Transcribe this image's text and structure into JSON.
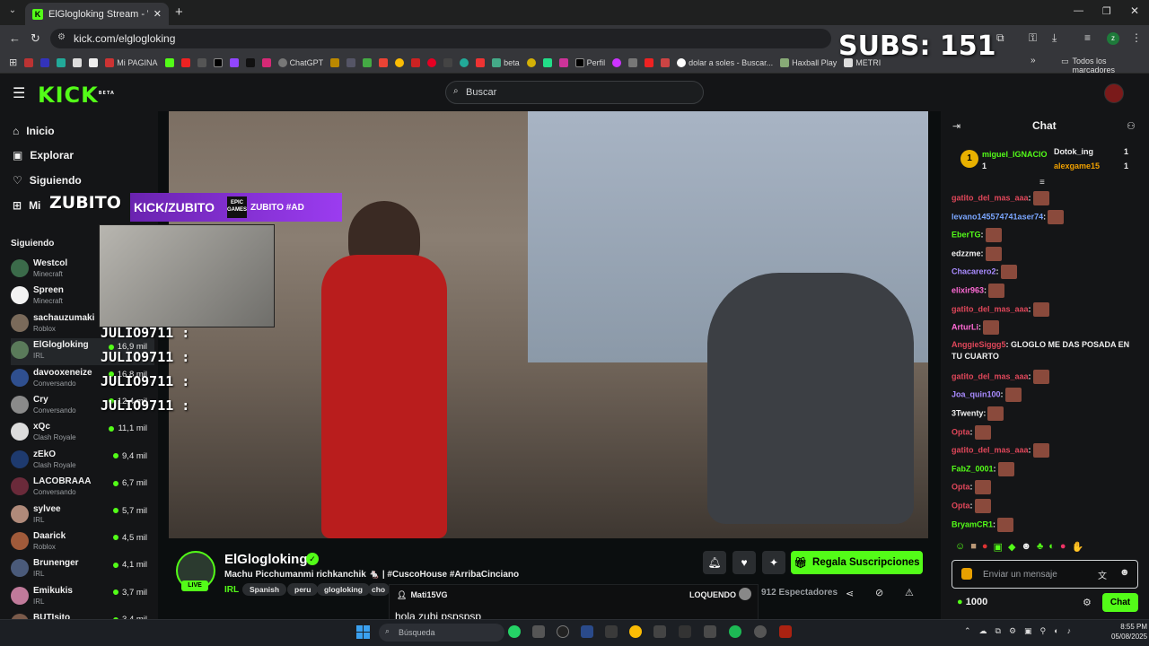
{
  "browser": {
    "tab_title": "ElGlogloking Stream - Watch L",
    "url": "kick.com/elglogloking",
    "bookmarks": [
      "Mi PAGINA",
      "ChatGPT",
      "beta",
      "Perfil",
      "dolar a soles - Buscar...",
      "Haxball Play",
      "METRI",
      "Todos los marcadores"
    ]
  },
  "overlay": {
    "subs_text": "SUBS: 151",
    "banner_text": "KICK/ZUBITO",
    "zubito_logo": "ZUBITO",
    "epic": "EPIC",
    "epic_sub": "GAMES",
    "code_label": "ZUBITO #AD",
    "julio_lines": [
      "JULIO9711 :",
      "JULIO9711 :",
      "JULIO9711 :",
      "JULIO9711 :"
    ]
  },
  "kick": {
    "logo": "KICK",
    "beta": "BETA",
    "search_placeholder": "Buscar"
  },
  "sidebar": {
    "nav": [
      {
        "label": "Inicio",
        "icon": "home-icon"
      },
      {
        "label": "Explorar",
        "icon": "compass-icon"
      },
      {
        "label": "Siguiendo",
        "icon": "heart-icon"
      },
      {
        "label": "Mi",
        "icon": "grid-icon"
      }
    ],
    "following_heading": "Siguiendo",
    "following": [
      {
        "name": "Westcol",
        "category": "Minecraft",
        "viewers": "",
        "color": "#3b6b4a"
      },
      {
        "name": "Spreen",
        "category": "Minecraft",
        "viewers": "",
        "color": "#f2f2f2"
      },
      {
        "name": "sachauzumaki",
        "category": "Roblox",
        "viewers": "",
        "color": "#7a6a5a"
      },
      {
        "name": "ElGlogloking",
        "category": "IRL",
        "viewers": "16,9 mil",
        "color": "#5a7a5a"
      },
      {
        "name": "davooxeneize",
        "category": "Conversando",
        "viewers": "16,8 mil",
        "color": "#2f4f8f"
      },
      {
        "name": "Cry",
        "category": "Conversando",
        "viewers": "12,4 mil",
        "color": "#8a8a8a"
      },
      {
        "name": "xQc",
        "category": "Clash Royale",
        "viewers": "11,1 mil",
        "color": "#dcdcdc"
      },
      {
        "name": "zEkO",
        "category": "Clash Royale",
        "viewers": "9,4 mil",
        "color": "#1e3a6e"
      },
      {
        "name": "LACOBRAAA",
        "category": "Conversando",
        "viewers": "6,7 mil",
        "color": "#6a2a3a"
      },
      {
        "name": "sylvee",
        "category": "IRL",
        "viewers": "5,7 mil",
        "color": "#b08a7a"
      },
      {
        "name": "Daarick",
        "category": "Roblox",
        "viewers": "4,5 mil",
        "color": "#a05a3a"
      },
      {
        "name": "Brunenger",
        "category": "IRL",
        "viewers": "4,1 mil",
        "color": "#4a5a7a"
      },
      {
        "name": "Emikukis",
        "category": "IRL",
        "viewers": "3,7 mil",
        "color": "#c07a9a"
      },
      {
        "name": "BUTIsito",
        "category": "",
        "viewers": "3,4 mil",
        "color": "#7a5a4a"
      }
    ]
  },
  "stream": {
    "streamer": "ElGlogloking",
    "live": "LIVE",
    "title": "Machu Picchumanmi richkanchik 🐁 | #CuscoHouse #ArribaCinciano",
    "category": "IRL",
    "tags": [
      "Spanish",
      "peru",
      "glogloking",
      "cho"
    ],
    "gift_label": "Regala Suscripciones",
    "viewers": "912 Espectadores"
  },
  "chat_popup": {
    "user": "Mati15VG",
    "right_user": "LOQUENDO",
    "message": "hola zubi pspspsp"
  },
  "chat": {
    "title": "Chat",
    "top_gifters": [
      {
        "name": "miguel_IGNACIO",
        "count": "1"
      },
      {
        "name": "Dotok_ing",
        "count": "1"
      },
      {
        "name": "alexgame15",
        "count": "1"
      }
    ],
    "messages": [
      {
        "user": "gatito_del_mas_aaa",
        "color": "#e0475a",
        "text": ""
      },
      {
        "user": "levano145574741aser74",
        "color": "#7aa6ff",
        "text": ""
      },
      {
        "user": "EberTG",
        "color": "#53fc18",
        "text": ""
      },
      {
        "user": "edzzme",
        "color": "#f0f0f0",
        "text": ""
      },
      {
        "user": "Chacarero2",
        "color": "#a98bff",
        "text": ""
      },
      {
        "user": "elixir963",
        "color": "#ff6ad5",
        "text": ""
      },
      {
        "user": "gatito_del_mas_aaa",
        "color": "#e0475a",
        "text": ""
      },
      {
        "user": "ArturLi",
        "color": "#ff6ad5",
        "text": ""
      },
      {
        "user": "AnggieSiggg5",
        "color": "#e0475a",
        "text": "GLOGLO ME DAS POSADA EN TU CUARTO"
      },
      {
        "user": "gatito_del_mas_aaa",
        "color": "#e0475a",
        "text": ""
      },
      {
        "user": "Joa_quin100",
        "color": "#a98bff",
        "text": ""
      },
      {
        "user": "3Twenty",
        "color": "#f0f0f0",
        "text": ""
      },
      {
        "user": "Opta",
        "color": "#e0475a",
        "text": ""
      },
      {
        "user": "gatito_del_mas_aaa",
        "color": "#e0475a",
        "text": ""
      },
      {
        "user": "FabZ_0001",
        "color": "#53fc18",
        "text": ""
      },
      {
        "user": "Opta",
        "color": "#e0475a",
        "text": ""
      },
      {
        "user": "Opta",
        "color": "#e0475a",
        "text": ""
      },
      {
        "user": "BryamCR1",
        "color": "#53fc18",
        "text": ""
      }
    ],
    "input_placeholder": "Enviar un mensaje",
    "points": "1000",
    "send_label": "Chat"
  },
  "taskbar": {
    "search_placeholder": "Búsqueda",
    "time": "8:55 PM",
    "date": "05/08/2025"
  }
}
